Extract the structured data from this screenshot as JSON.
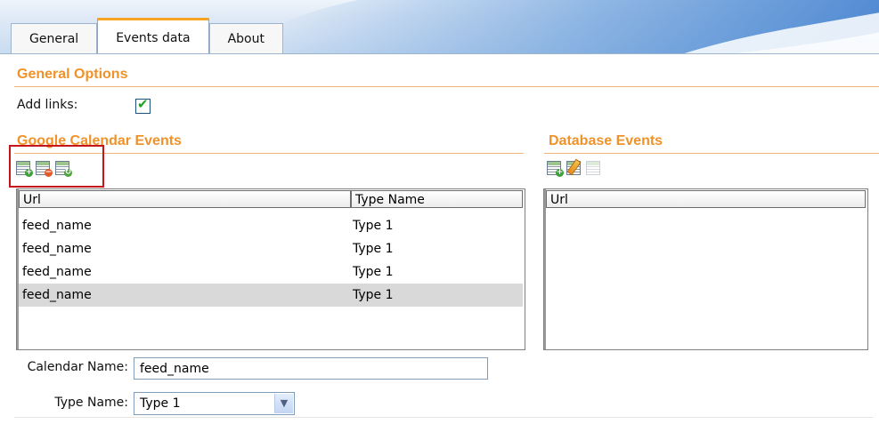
{
  "tabs": [
    {
      "label": "General",
      "active": false
    },
    {
      "label": "Events data",
      "active": true
    },
    {
      "label": "About",
      "active": false
    }
  ],
  "general_options": {
    "title": "General Options",
    "add_links_label": "Add links:",
    "add_links_checked": true
  },
  "google_calendar": {
    "title": "Google Calendar Events",
    "toolbar": [
      "add-row-icon",
      "delete-row-icon",
      "refresh-row-icon"
    ],
    "columns": [
      "Url",
      "Type Name"
    ],
    "rows": [
      {
        "url": "feed_name",
        "type": "Type 1",
        "selected": false
      },
      {
        "url": "feed_name",
        "type": "Type 1",
        "selected": false
      },
      {
        "url": "feed_name",
        "type": "Type 1",
        "selected": false
      },
      {
        "url": "feed_name",
        "type": "Type 1",
        "selected": true
      }
    ],
    "calendar_name_label": "Calendar Name:",
    "calendar_name_value": "feed_name",
    "type_name_label": "Type Name:",
    "type_name_value": "Type 1"
  },
  "database_events": {
    "title": "Database Events",
    "toolbar": [
      "add-row-icon",
      "edit-row-icon",
      "disabled-row-icon"
    ],
    "columns": [
      "Url"
    ]
  },
  "colors": {
    "section_title": "#f0922a",
    "active_tab_accent": "#f6a623",
    "highlight_box": "#c5151b",
    "selected_row": "#d9d9d9"
  }
}
